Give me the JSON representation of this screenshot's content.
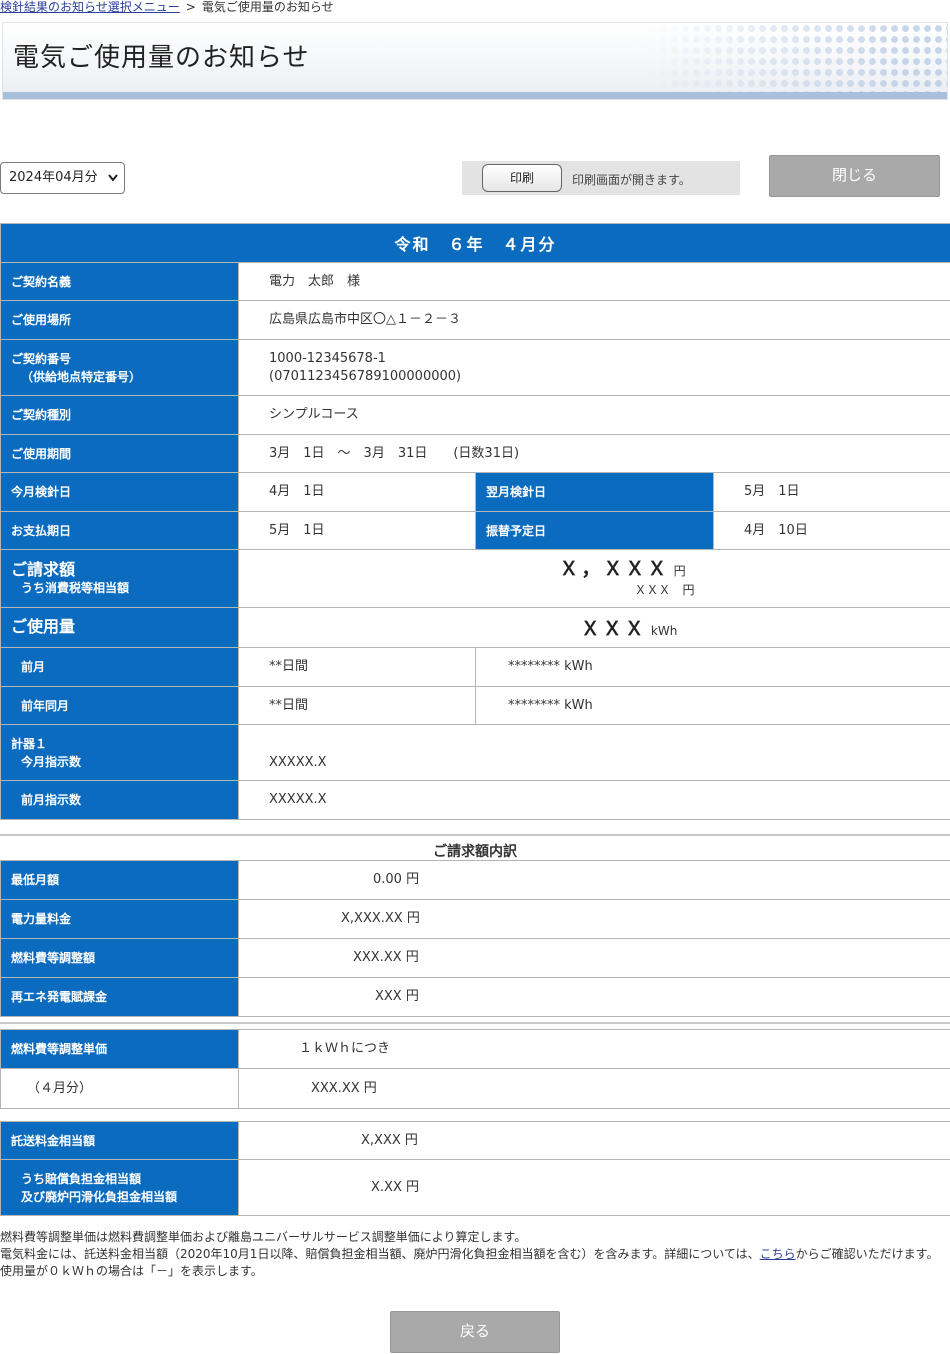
{
  "breadcrumb": {
    "parent_link": "検針結果のお知らせ選択メニュー",
    "separator": ">",
    "current": "電気ご使用量のお知らせ"
  },
  "header": {
    "title": "電気ご使用量のお知らせ"
  },
  "controls": {
    "month_select_value": "2024年04月分",
    "print_button": "印刷",
    "print_note": "印刷画面が開きます。",
    "close_button": "閉じる"
  },
  "info": {
    "title": "令和　６年　４月分",
    "contract_name_label": "ご契約名義",
    "contract_name_value": "電力　太郎　様",
    "location_label": "ご使用場所",
    "location_value": "広島県広島市中区〇△１－２－３",
    "contract_no_label1": "ご契約番号",
    "contract_no_label2": "（供給地点特定番号）",
    "contract_no_value1": "1000-12345678-1",
    "contract_no_value2": "(0701123456789100000000)",
    "contract_type_label": "ご契約種別",
    "contract_type_value": "シンプルコース",
    "period_label": "ご使用期間",
    "period_value": "3月　1日　～　3月　31日　　(日数31日)",
    "this_meter_label": "今月検針日",
    "this_meter_value": "4月　1日",
    "next_meter_label": "翌月検針日",
    "next_meter_value": "5月　1日",
    "pay_due_label": "お支払期日",
    "pay_due_value": "5月　1日",
    "transfer_label": "振替予定日",
    "transfer_value": "4月　10日",
    "billing_label": "ご請求額",
    "billing_tax_label": "うち消費税等相当額",
    "billing_amount": "Ｘ，ＸＸＸ",
    "billing_unit": "円",
    "billing_tax_amount": "ＸＸＸ　円",
    "usage_label": "ご使用量",
    "usage_amount": "ＸＸＸ",
    "usage_unit": "kWh",
    "prev_month_label": "前月",
    "prev_month_days": "**日間",
    "prev_month_kwh": "******** kWh",
    "prev_year_label": "前年同月",
    "prev_year_days": "**日間",
    "prev_year_kwh": "******** kWh",
    "meter_label": "計器１",
    "this_reading_label": "今月指示数",
    "this_reading_value": "XXXXX.X",
    "prev_reading_label": "前月指示数",
    "prev_reading_value": "XXXXX.X"
  },
  "breakdown": {
    "title": "ご請求額内訳",
    "rows": [
      {
        "label": "最低月額",
        "value": "0.00 円"
      },
      {
        "label": "電力量料金",
        "value": "X,XXX.XX 円"
      },
      {
        "label": "燃料費等調整額",
        "value": "XXX.XX 円"
      },
      {
        "label": "再エネ発電賦課金",
        "value": "XXX 円"
      }
    ]
  },
  "fuel_unit": {
    "label": "燃料費等調整単価",
    "per_kwh": "１ｋＷｈにつき",
    "month_label": "（４月分）",
    "value": "XXX.XX 円"
  },
  "transmission": {
    "label": "託送料金相当額",
    "value": "X,XXX 円",
    "sub_label1": "うち賠償負担金相当額",
    "sub_label2": "及び廃炉円滑化負担金相当額",
    "sub_value": "X.XX 円"
  },
  "notes": {
    "line1": "燃料費等調整単価は燃料費調整単価および離島ユニバーサルサービス調整単価により算定します。",
    "line2_before": "電気料金には、託送料金相当額（2020年10月1日以降、賠償負担金相当額、廃炉円滑化負担金相当額を含む）を含みます。詳細については、",
    "line2_link": "こちら",
    "line2_after": "からご確認いただけます。",
    "line3": "使用量が０ｋＷｈの場合は「－」を表示します。"
  },
  "back_button": "戻る",
  "colors": {
    "label_bg": "#0a6bbf",
    "button_gray": "#a9a9a9",
    "border": "#b5b5b5"
  }
}
